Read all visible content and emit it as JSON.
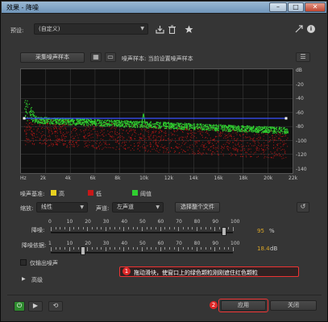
{
  "window": {
    "title": "效果 - 降噪"
  },
  "preset": {
    "label": "预设:",
    "value": "(自定义)"
  },
  "capture": {
    "button_label": "采集噪声样本",
    "status": "噪声样本: 当前设置噪声样本"
  },
  "graph_axis": {
    "x_ticks": [
      "Hz",
      "2k",
      "4k",
      "6k",
      "8k",
      "10k",
      "12k",
      "14k",
      "16k",
      "18k",
      "20k",
      "22k"
    ],
    "y_ticks": [
      "dB",
      "-20",
      "-40",
      "-60",
      "-80",
      "-100",
      "-120",
      "-140"
    ]
  },
  "legend": {
    "label": "噪声基准:",
    "items": [
      {
        "label": "高",
        "color": "#e8d020"
      },
      {
        "label": "低",
        "color": "#c81818"
      },
      {
        "label": "阈值",
        "color": "#30d030"
      }
    ]
  },
  "controls": {
    "scale_label": "缩放:",
    "scale_value": "线性",
    "channel_label": "声道:",
    "channel_value": "左声道",
    "select_file_button": "选择整个文件"
  },
  "noise_reduction": {
    "label": "降噪:",
    "ticks": [
      "0",
      "10",
      "20",
      "30",
      "40",
      "50",
      "60",
      "70",
      "80",
      "90",
      "100"
    ],
    "value": "95",
    "unit": "%",
    "level_fraction": 0.95
  },
  "reduce_by": {
    "label": "降噪依据:",
    "ticks": [
      "1",
      "10",
      "20",
      "30",
      "40",
      "50",
      "60",
      "70",
      "80",
      "90",
      "100"
    ],
    "value": "18.4",
    "unit": "dB",
    "level_fraction": 0.178
  },
  "output_noise_only": {
    "label": "仅输出噪声"
  },
  "advanced": {
    "label": "高级"
  },
  "annotation": {
    "step1_number": "1",
    "step1_text": "拖动滑块，使窗口上的绿色颗粒刚刚遮住红色颗粒",
    "step2_number": "2"
  },
  "footer": {
    "apply_button": "应用",
    "close_button": "关闭"
  },
  "colors": {
    "threshold": "#30d030",
    "low": "#c81818",
    "high_line": "#3a52ff",
    "accent": "#d9a528",
    "annotation": "#e02828"
  },
  "icons": {
    "save": "save-preset-icon",
    "delete": "delete-preset-icon",
    "favorite": "star-icon",
    "menu": "panel-menu-icon",
    "info": "info-icon"
  }
}
